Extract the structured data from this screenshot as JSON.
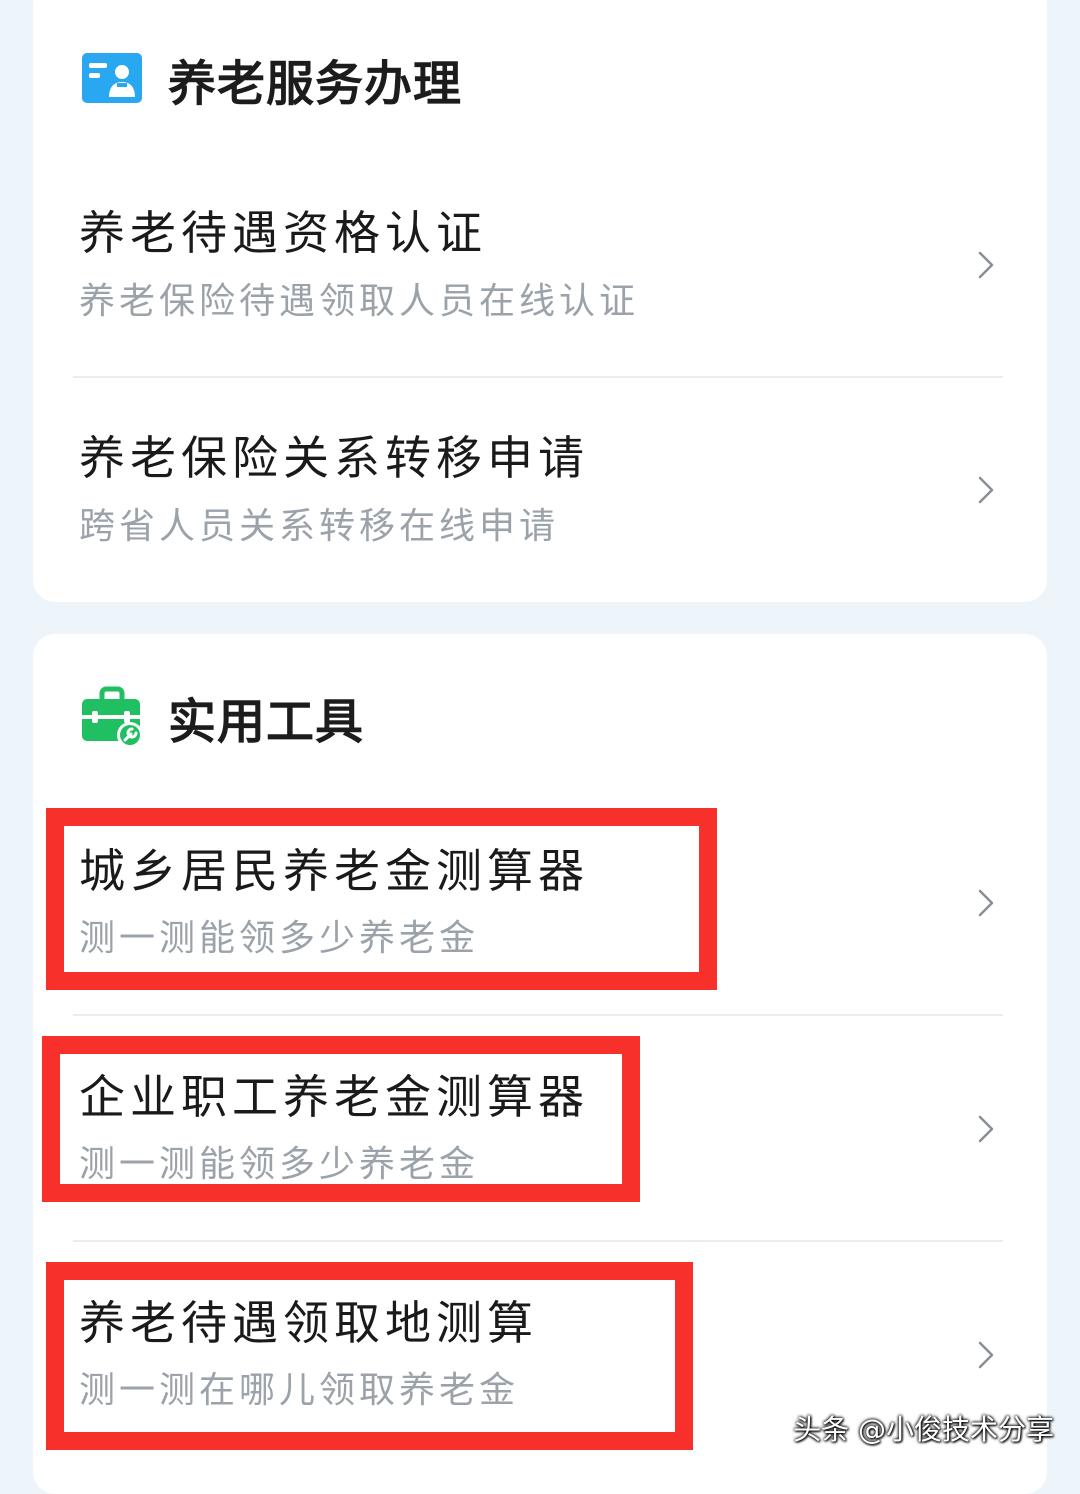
{
  "service_section": {
    "title": "养老服务办理",
    "items": [
      {
        "title": "养老待遇资格认证",
        "subtitle": "养老保险待遇领取人员在线认证"
      },
      {
        "title": "养老保险关系转移申请",
        "subtitle": "跨省人员关系转移在线申请"
      }
    ]
  },
  "tools_section": {
    "title": "实用工具",
    "items": [
      {
        "title": "城乡居民养老金测算器",
        "subtitle": "测一测能领多少养老金"
      },
      {
        "title": "企业职工养老金测算器",
        "subtitle": "测一测能领多少养老金"
      },
      {
        "title": "养老待遇领取地测算",
        "subtitle": "测一测在哪儿领取养老金"
      }
    ]
  },
  "icons": {
    "service_header": "id-card-person-icon",
    "tools_header": "toolbox-wrench-icon",
    "row_arrow": "chevron-right-icon"
  },
  "colors": {
    "service_icon": "#2aa7f1",
    "tools_icon": "#1fbf62",
    "highlight_box": "#f7302c",
    "subtitle_text": "#9ba2aa"
  },
  "watermark": "头条 @小俊技术分享"
}
